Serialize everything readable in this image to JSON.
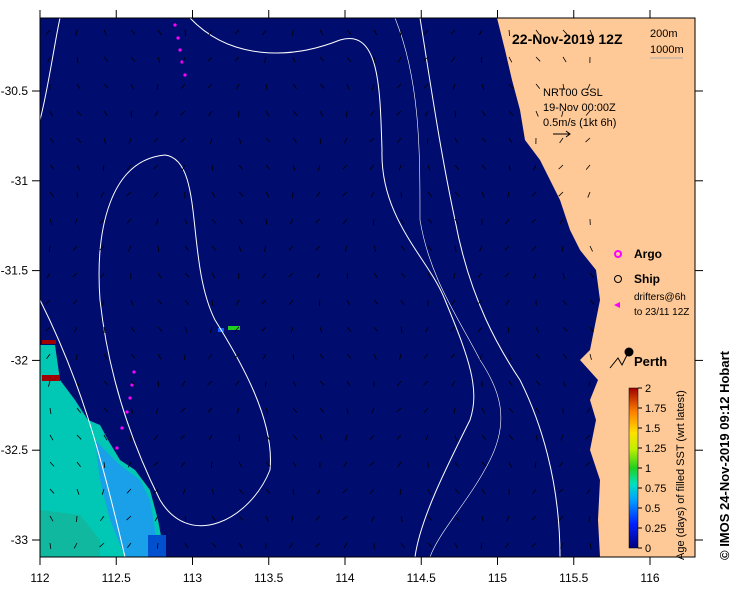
{
  "map": {
    "title": "22-Nov-2019 12Z",
    "depth_legend": {
      "contour_1": "200m",
      "contour_2": "1000m"
    },
    "current_info": {
      "line1": "NRT00 GSL",
      "line2": "19-Nov 00:00Z",
      "line3": "0.5m/s (1kt 6h)"
    },
    "legend": {
      "argo": "Argo",
      "ship": "Ship",
      "drifters_line1": "drifters@6h",
      "drifters_line2": "to 23/11 12Z"
    },
    "city": "Perth",
    "x_ticks": [
      "112",
      "112.5",
      "113",
      "113.5",
      "114",
      "114.5",
      "115",
      "115.5",
      "116"
    ],
    "y_ticks": [
      "-30.5",
      "-31",
      "-31.5",
      "-32",
      "-32.5",
      "-33"
    ],
    "colorbar": {
      "label": "Age (days) of filled SST (wrt latest)",
      "ticks": [
        "0",
        "0.25",
        "0.5",
        "0.75",
        "1",
        "1.25",
        "1.5",
        "1.75",
        "2"
      ],
      "range": [
        0,
        2
      ]
    },
    "credit": "© IMOS 24-Nov-2019 09:12 Hobart",
    "colors": {
      "ocean": "#000d6e",
      "land": "#fec996",
      "argo": "#ff00ff",
      "drifter": "#ff00ff",
      "contour": "#ffffff"
    }
  }
}
